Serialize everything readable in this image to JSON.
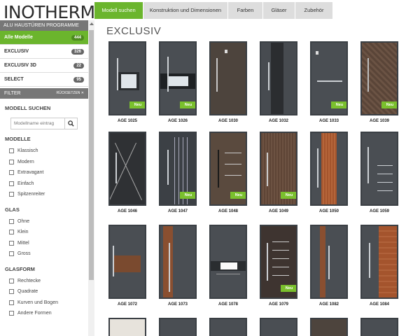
{
  "brand": {
    "logo": "INOTHERM"
  },
  "topnav": [
    "Modell suchen",
    "Konstruktion und Dimensionen",
    "Farben",
    "Gläser",
    "Zubehör"
  ],
  "sidebar": {
    "header": "ALU HAUSTÜREN PROGRAMME",
    "programs": [
      {
        "label": "Alle Modelle",
        "count": "444"
      },
      {
        "label": "EXCLUSIV",
        "count": "326"
      },
      {
        "label": "EXCLUSIV 3D",
        "count": "22"
      },
      {
        "label": "SELECT",
        "count": "95"
      }
    ],
    "filter": {
      "label": "FILTER",
      "reset": "RÜCKSETZEN"
    },
    "model_search": {
      "title": "MODELL SUCHEN",
      "placeholder": "Modellname eintrag"
    },
    "groups": [
      {
        "title": "MODELLE",
        "options": [
          "Klassisch",
          "Modern",
          "Extravagant",
          "Einfach",
          "Spitzenreiter"
        ]
      },
      {
        "title": "GLAS",
        "options": [
          "Ohne",
          "Klein",
          "Mittel",
          "Gross"
        ]
      },
      {
        "title": "GLASFORM",
        "options": [
          "Rechtecke",
          "Quadrate",
          "Kurven und Bogen",
          "Andere Formen"
        ]
      }
    ]
  },
  "main": {
    "title": "EXCLUSIV",
    "new_label": "Neu",
    "rows": [
      [
        {
          "name": "AGE 1025",
          "new": true,
          "color": "#4a4e53",
          "style": "glass-center"
        },
        {
          "name": "AGE 1026",
          "new": true,
          "color": "#4a4e53",
          "style": "glass-band"
        },
        {
          "name": "AGE 1030",
          "new": false,
          "color": "#4d443d",
          "style": "plain-handle"
        },
        {
          "name": "AGE 1032",
          "new": false,
          "color": "#474b50",
          "style": "dark-strip"
        },
        {
          "name": "AGE 1033",
          "new": true,
          "color": "#4a4e53",
          "style": "bar-handle"
        },
        {
          "name": "AGE 1039",
          "new": true,
          "color": "#5c4639",
          "style": "stone"
        }
      ],
      [
        {
          "name": "AGE 1046",
          "new": false,
          "color": "#2f3134",
          "style": "cross-lines"
        },
        {
          "name": "AGE 1047",
          "new": true,
          "color": "#3c4045",
          "style": "vertical-lines"
        },
        {
          "name": "AGE 1048",
          "new": true,
          "color": "#5a4a3e",
          "style": "wood-h"
        },
        {
          "name": "AGE 1049",
          "new": true,
          "color": "#5e4536",
          "style": "wood-dark"
        },
        {
          "name": "AGE 1050",
          "new": false,
          "color": "#4a4e53",
          "style": "wood-panel"
        },
        {
          "name": "AGE 1059",
          "new": false,
          "color": "#4a4e53",
          "style": "lines-right"
        }
      ],
      [
        {
          "name": "AGE 1072",
          "new": false,
          "color": "#4a4e53",
          "style": "wood-mid"
        },
        {
          "name": "AGE 1073",
          "new": false,
          "color": "#4a4e53",
          "style": "wood-left"
        },
        {
          "name": "AGE 1078",
          "new": false,
          "color": "#4a4e53",
          "style": "glass-low"
        },
        {
          "name": "AGE 1079",
          "new": true,
          "color": "#3e3430",
          "style": "dark-lines"
        },
        {
          "name": "AGE 1082",
          "new": false,
          "color": "#4a4e53",
          "style": "wood-stripe"
        },
        {
          "name": "AGE 1084",
          "new": false,
          "color": "#4a4e53",
          "style": "wood-right"
        }
      ]
    ]
  }
}
